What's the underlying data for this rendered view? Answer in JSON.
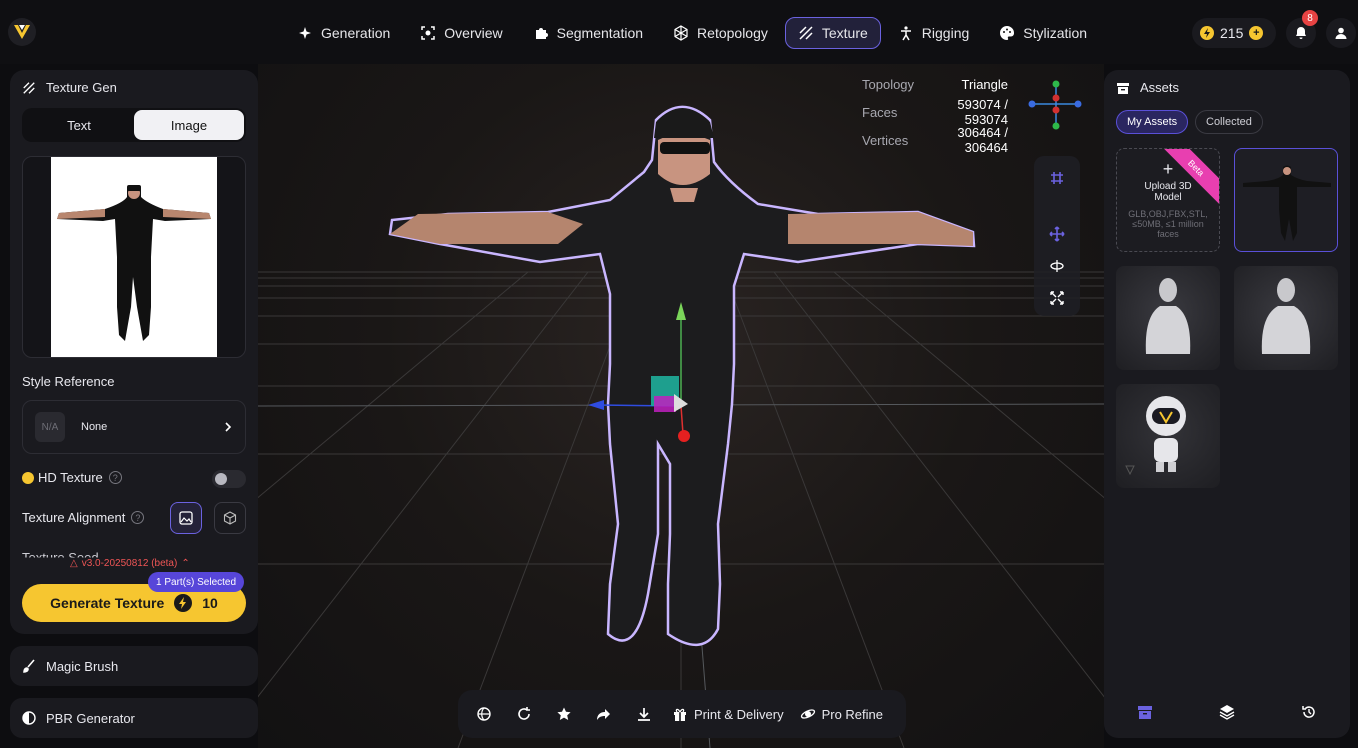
{
  "topbar": {
    "nav": [
      {
        "label": "Generation",
        "icon": "sparkle-icon"
      },
      {
        "label": "Overview",
        "icon": "scan-icon"
      },
      {
        "label": "Segmentation",
        "icon": "puzzle-icon"
      },
      {
        "label": "Retopology",
        "icon": "mesh-icon"
      },
      {
        "label": "Texture",
        "icon": "texture-icon",
        "active": true
      },
      {
        "label": "Rigging",
        "icon": "figure-icon"
      },
      {
        "label": "Stylization",
        "icon": "palette-icon"
      }
    ],
    "credits": "215",
    "notifications": "8"
  },
  "viewport": {
    "stats": {
      "topology_label": "Topology",
      "topology_value": "Triangle",
      "faces_label": "Faces",
      "faces_value": "593074 / 593074",
      "vertices_label": "Vertices",
      "vertices_value": "306464 / 306464"
    },
    "bottom": {
      "print_label": "Print & Delivery",
      "refine_label": "Pro Refine"
    }
  },
  "left": {
    "title": "Texture Gen",
    "tab_text": "Text",
    "tab_image": "Image",
    "style_ref_label": "Style Reference",
    "style_ref_na": "N/A",
    "style_ref_value": "None",
    "hd_label": "HD Texture",
    "align_label": "Texture Alignment",
    "seed_label": "Texture Seed",
    "version": "v3.0-20250812 (beta)",
    "parts_selected": "1 Part(s) Selected",
    "generate_label": "Generate Texture",
    "generate_cost": "10",
    "magic_brush": "Magic Brush",
    "pbr": "PBR Generator"
  },
  "right": {
    "title": "Assets",
    "tab_my": "My Assets",
    "tab_collected": "Collected",
    "upload_title": "Upload 3D Model",
    "upload_hint": "GLB,OBJ,FBX,STL, ≤50MB, ≤1 million faces",
    "beta": "Beta"
  },
  "colors": {
    "accent": "#6b62e0",
    "gold": "#f6c630",
    "badge": "#5746d9"
  }
}
